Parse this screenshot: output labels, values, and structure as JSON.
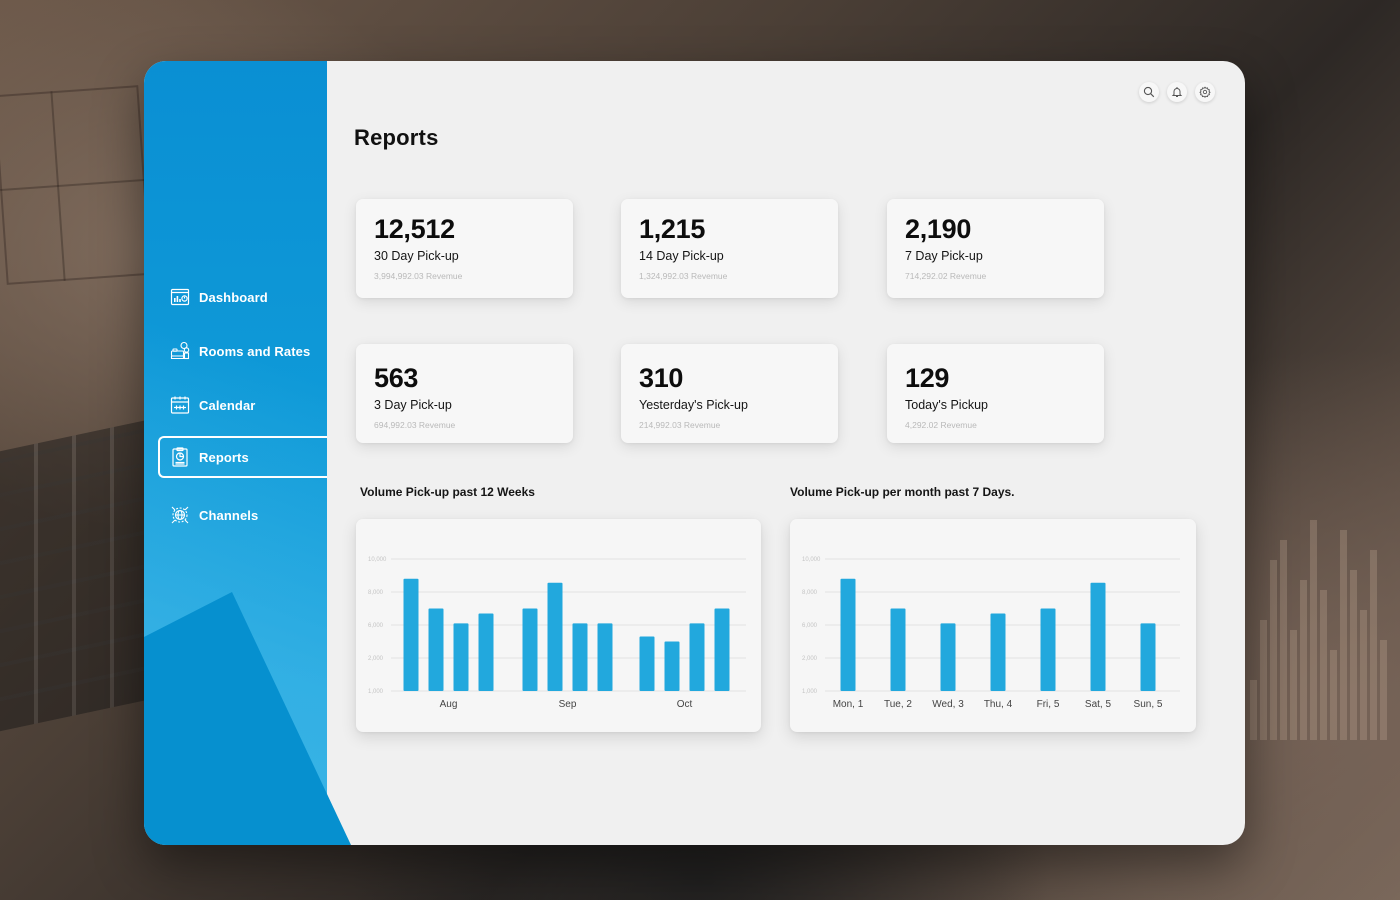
{
  "page": {
    "title": "Reports"
  },
  "top_icons": [
    {
      "name": "search-icon",
      "label": "Search"
    },
    {
      "name": "bell-icon",
      "label": "Notifications"
    },
    {
      "name": "gear-icon",
      "label": "Settings"
    }
  ],
  "sidebar": {
    "items": [
      {
        "label": "Dashboard",
        "icon": "dashboard-icon",
        "active": false
      },
      {
        "label": "Rooms and Rates",
        "icon": "rooms-rates-icon",
        "active": false
      },
      {
        "label": "Calendar",
        "icon": "calendar-icon",
        "active": false
      },
      {
        "label": "Reports",
        "icon": "reports-icon",
        "active": true
      },
      {
        "label": "Channels",
        "icon": "channels-icon",
        "active": false
      }
    ]
  },
  "stats": [
    {
      "value": "12,512",
      "label": "30 Day Pick-up",
      "sub": "3,994,992.03 Revemue"
    },
    {
      "value": "1,215",
      "label": "14 Day Pick-up",
      "sub": "1,324,992.03 Revemue"
    },
    {
      "value": "2,190",
      "label": "7 Day Pick-up",
      "sub": "714,292.02 Revemue"
    },
    {
      "value": "563",
      "label": "3 Day Pick-up",
      "sub": "694,992.03 Revemue"
    },
    {
      "value": "310",
      "label": "Yesterday's Pick-up",
      "sub": "214,992.03 Revemue"
    },
    {
      "value": "129",
      "label": "Today's Pickup",
      "sub": "4,292.02 Revemue"
    }
  ],
  "colors": {
    "accent": "#0a8fd3",
    "bar": "#22a8dd"
  },
  "chart_data": [
    {
      "type": "bar",
      "title": "Volume Pick-up past 12 Weeks",
      "xlabel": "",
      "ylabel": "",
      "y_ticks": [
        "1,000",
        "2,000",
        "6,000",
        "8,000",
        "10,000"
      ],
      "y_tick_values": [
        1000,
        2000,
        6000,
        8000,
        10000
      ],
      "ylim": [
        1000,
        10000
      ],
      "grid": true,
      "legend": "none",
      "groups": [
        {
          "label": "Aug",
          "values": [
            8800,
            7000,
            6100,
            6700
          ]
        },
        {
          "label": "Sep",
          "values": [
            7000,
            8560,
            6100,
            6100
          ]
        },
        {
          "label": "Oct",
          "values": [
            4600,
            4000,
            6100,
            7000
          ]
        }
      ]
    },
    {
      "type": "bar",
      "title": "Volume Pick-up per month past 7 Days.",
      "xlabel": "",
      "ylabel": "",
      "y_ticks": [
        "1,000",
        "2,000",
        "6,000",
        "8,000",
        "10,000"
      ],
      "y_tick_values": [
        1000,
        2000,
        6000,
        8000,
        10000
      ],
      "ylim": [
        1000,
        10000
      ],
      "grid": true,
      "legend": "none",
      "categories": [
        "Mon, 1",
        "Tue, 2",
        "Wed, 3",
        "Thu, 4",
        "Fri, 5",
        "Sat, 5",
        "Sun, 5"
      ],
      "values": [
        8800,
        7000,
        6100,
        6700,
        7000,
        8560,
        6100
      ]
    }
  ]
}
